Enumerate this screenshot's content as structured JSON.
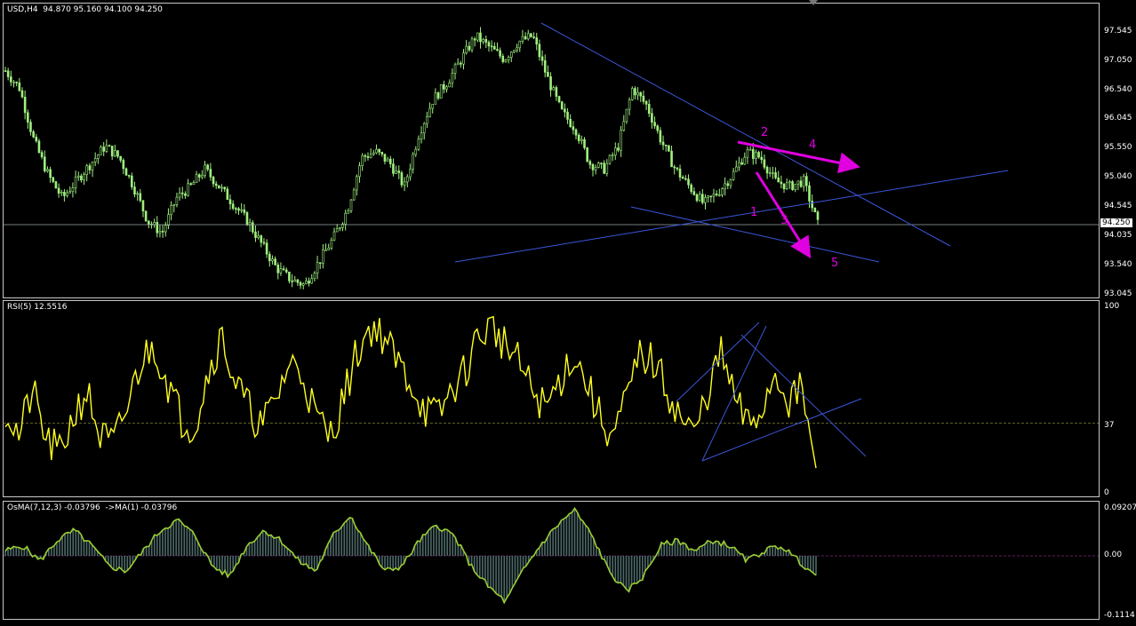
{
  "main": {
    "title": "USD,H4  94.870 95.160 94.100 94.250",
    "current_price": "94.250",
    "ticks": [
      "97.545",
      "97.050",
      "96.540",
      "96.045",
      "95.550",
      "95.040",
      "94.545",
      "94.035",
      "93.540",
      "93.045"
    ],
    "ylim": [
      93.0,
      97.8
    ],
    "wave_labels": [
      "1",
      "2",
      "3",
      "4",
      "5"
    ]
  },
  "rsi": {
    "title": "RSI(5) 12.5516",
    "level": "37",
    "ticks": [
      "100",
      "37",
      "0"
    ]
  },
  "osma": {
    "title": "OsMA(7,12,3) -0.03796  ->MA(1) -0.03796",
    "ticks": [
      "0.09207",
      "0.00",
      "-0.1114"
    ]
  },
  "colors": {
    "candle": "#a0f080",
    "rsi_line": "#ffff20",
    "trendline": "#3b56d8",
    "wave_arrow": "#e000e0",
    "osma_line": "#9acd32",
    "osma_hist": "#4e6a6a"
  },
  "chart_data": [
    {
      "type": "candlestick",
      "name": "USD,H4",
      "ylim": [
        93.0,
        97.8
      ],
      "close_path": [
        96.9,
        96.6,
        95.7,
        95.1,
        94.7,
        95.0,
        95.3,
        95.6,
        95.4,
        94.9,
        94.3,
        94.1,
        94.7,
        94.9,
        95.2,
        94.9,
        94.6,
        94.3,
        93.9,
        93.5,
        93.3,
        93.2,
        93.6,
        94.0,
        94.5,
        95.4,
        95.5,
        95.3,
        94.9,
        95.8,
        96.4,
        96.7,
        97.1,
        97.5,
        97.3,
        97.1,
        97.4,
        97.5,
        96.8,
        96.2,
        95.9,
        95.3,
        95.2,
        95.6,
        96.6,
        96.3,
        95.7,
        95.2,
        94.9,
        94.6,
        94.8,
        95.1,
        95.5,
        95.4,
        95.0,
        94.9,
        95.0,
        94.25
      ]
    },
    {
      "type": "line",
      "name": "RSI(5)",
      "ylim": [
        0,
        100
      ],
      "values": [
        45,
        30,
        55,
        28,
        20,
        40,
        55,
        30,
        25,
        45,
        70,
        80,
        60,
        40,
        35,
        65,
        85,
        60,
        45,
        35,
        50,
        70,
        65,
        40,
        30,
        50,
        75,
        90,
        85,
        70,
        60,
        45,
        40,
        55,
        65,
        85,
        90,
        80,
        70,
        55,
        45,
        60,
        75,
        60,
        40,
        30,
        50,
        75,
        70,
        55,
        40,
        30,
        55,
        75,
        50,
        35,
        45,
        65,
        50,
        55,
        12.5516
      ]
    },
    {
      "type": "bar",
      "name": "OsMA(7,12,3)",
      "ylim": [
        -0.1114,
        0.09207
      ],
      "values": [
        0.01,
        0.02,
        -0.01,
        0.03,
        0.05,
        0.02,
        -0.02,
        -0.03,
        0.01,
        0.05,
        0.07,
        0.04,
        -0.02,
        -0.04,
        0.02,
        0.05,
        0.03,
        -0.01,
        -0.03,
        0.04,
        0.08,
        0.02,
        -0.03,
        -0.02,
        0.03,
        0.06,
        0.04,
        -0.02,
        -0.06,
        -0.09,
        -0.03,
        0.02,
        0.06,
        0.09,
        0.04,
        -0.03,
        -0.07,
        -0.04,
        0.02,
        0.03,
        0.01,
        0.03,
        0.02,
        -0.01,
        0.01,
        0.02,
        -0.01,
        -0.03797
      ]
    }
  ]
}
